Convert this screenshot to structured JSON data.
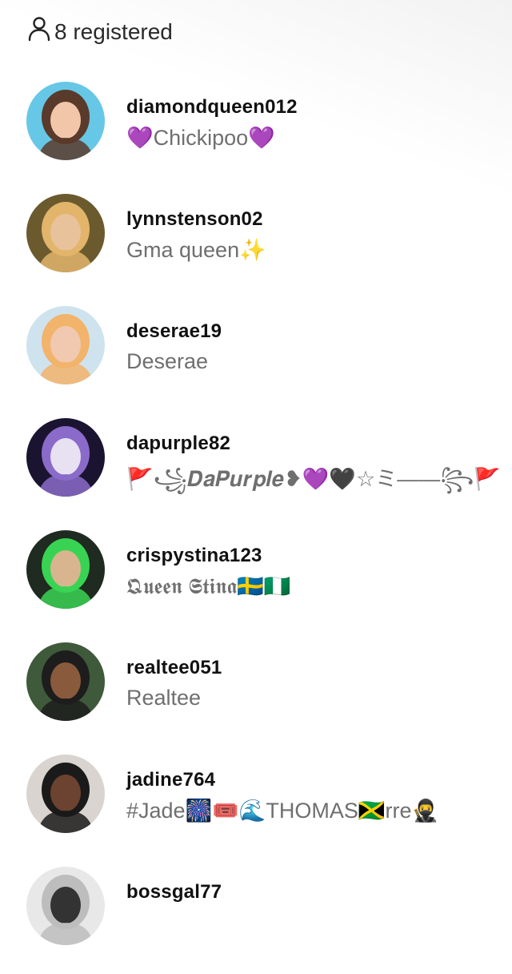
{
  "header": {
    "registered_label": "8 registered",
    "icon": "person-icon"
  },
  "users": [
    {
      "username": "diamondqueen012",
      "display_name": "💜Chickipoo💜",
      "avatar_colors": [
        "#67c7e6",
        "#5a3a2a",
        "#f2c6a8"
      ]
    },
    {
      "username": "lynnstenson02",
      "display_name": "Gma  queen✨",
      "avatar_colors": [
        "#6b5a2e",
        "#e2b56b",
        "#e8c29a"
      ]
    },
    {
      "username": "deserae19",
      "display_name": "Deserae",
      "avatar_colors": [
        "#cfe3ee",
        "#f2b36b",
        "#f1c9b1"
      ]
    },
    {
      "username": "dapurple82",
      "display_name": "🚩꧁𝑫𝒂𝑷𝒖𝒓𝒑𝒍𝒆❥💜🖤☆ミ——꧂🚩",
      "avatar_colors": [
        "#1b1430",
        "#8a6bc9",
        "#e7e1f2"
      ]
    },
    {
      "username": "crispystina123",
      "display_name": "𝕼𝖚𝖊𝖊𝖓 𝕾𝖙𝖎𝖓𝖆🇸🇪🇳🇬",
      "avatar_colors": [
        "#1f2a20",
        "#39d353",
        "#d8b58f"
      ]
    },
    {
      "username": "realtee051",
      "display_name": "Realtee",
      "avatar_colors": [
        "#3f5a3a",
        "#1d1d1d",
        "#8a5a3c"
      ]
    },
    {
      "username": "jadine764",
      "display_name": "#Jade🎆🎟️🌊THOMAS🇯🇲rre🥷",
      "avatar_colors": [
        "#d9d4cf",
        "#1a1a1a",
        "#6b4330"
      ]
    },
    {
      "username": "bossgal77",
      "display_name": "",
      "avatar_colors": [
        "#e8e8e8",
        "#bdbdbd",
        "#333333"
      ]
    }
  ]
}
